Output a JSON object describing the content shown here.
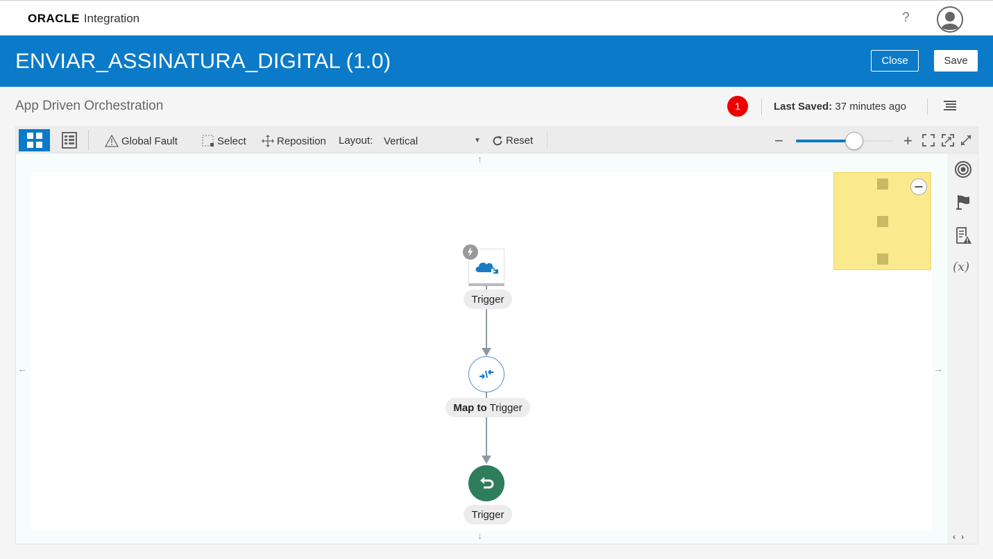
{
  "header": {
    "brand": "ORACLE",
    "product": "Integration",
    "help": "?"
  },
  "titlebar": {
    "title": "ENVIAR_ASSINATURA_DIGITAL (1.0)",
    "close_label": "Close",
    "save_label": "Save"
  },
  "subheader": {
    "style": "App Driven Orchestration",
    "error_count": "1",
    "last_saved_label": "Last Saved:",
    "last_saved_value": "37 minutes ago"
  },
  "toolbar": {
    "global_fault": "Global Fault",
    "select": "Select",
    "reposition": "Reposition",
    "layout_label": "Layout:",
    "layout_value": "Vertical",
    "reset": "Reset",
    "zoom_level": 0.6
  },
  "flow": {
    "trigger_label": "Trigger",
    "map_label_bold": "Map to",
    "map_label_rest": "Trigger",
    "return_label": "Trigger"
  },
  "icons": {
    "help": "help-icon",
    "avatar": "user-avatar-icon",
    "menu": "hamburger-menu-icon",
    "canvas_view": "canvas-view-icon",
    "list_view": "list-view-icon",
    "warning": "warning-icon",
    "select": "select-marquee-icon",
    "reposition": "move-icon",
    "reset": "refresh-icon",
    "fit": "fit-to-screen-icon",
    "actual_size": "actual-size-icon",
    "expand": "expand-icon",
    "tracking": "target-icon",
    "flag": "flag-icon",
    "errors": "errors-document-icon",
    "variables": "variables-icon"
  },
  "colors": {
    "brand_blue": "#0a7ac9",
    "error_red": "#ee0000",
    "return_green": "#2e7d5b",
    "minimap_yellow": "#fbe98d"
  }
}
